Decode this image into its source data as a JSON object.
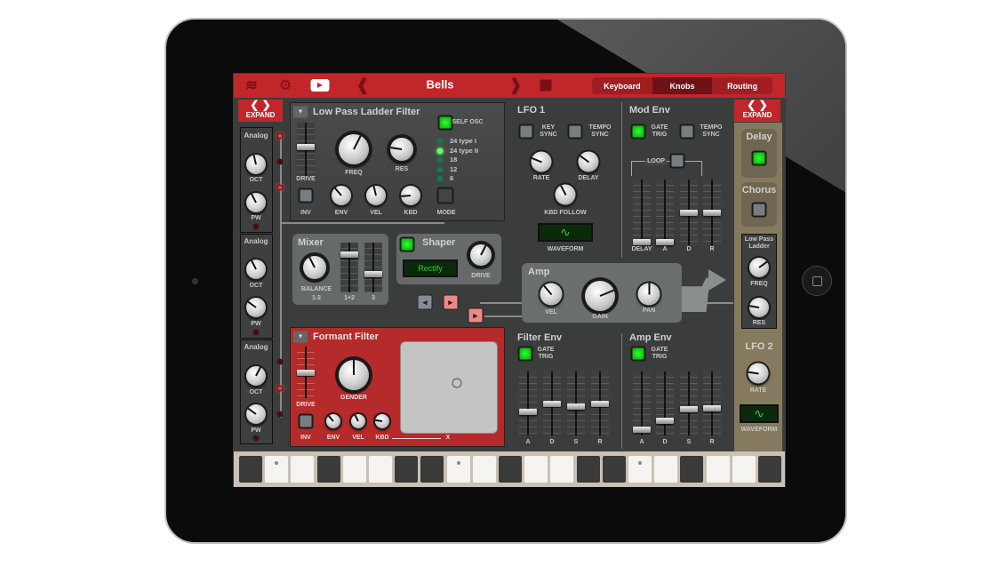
{
  "topbar": {
    "preset_name": "Bells",
    "tabs": [
      {
        "label": "Keyboard",
        "active": false
      },
      {
        "label": "Knobs",
        "active": true
      },
      {
        "label": "Routing",
        "active": false
      }
    ],
    "icons": [
      "logo-icon",
      "gear-icon",
      "video-play-icon",
      "chevron-left-icon",
      "chevron-right-icon",
      "save-icon"
    ]
  },
  "colors": {
    "accent_red": "#c1262b",
    "panel_bg": "#3e4040",
    "led_green": "#33ff33",
    "formant_red": "#b52a2a",
    "side_tan": "#8a7d62"
  },
  "left": {
    "expand": "EXPAND",
    "oscillators": [
      {
        "type": "Analog",
        "oct_label": "OCT",
        "pw_label": "PW",
        "oct": 0.45,
        "pw": 0.4
      },
      {
        "type": "Analog",
        "oct_label": "OCT",
        "pw_label": "PW",
        "oct": 0.4,
        "pw": 0.3
      },
      {
        "type": "Analog",
        "oct_label": "OCT",
        "pw_label": "PW",
        "oct": 0.6,
        "pw": 0.3
      }
    ]
  },
  "lpf": {
    "title": "Low Pass Ladder Filter",
    "self_osc": "SELF OSC",
    "self_osc_on": true,
    "drive_label": "DRIVE",
    "drive": 0.55,
    "freq_label": "FREQ",
    "freq": 0.6,
    "res_label": "RES",
    "res": 0.2,
    "inv_label": "INV",
    "env_label": "ENV",
    "env": 0.35,
    "vel_label": "VEL",
    "vel": 0.45,
    "kbd_label": "KBD",
    "kbd": 0.15,
    "mode_label": "MODE",
    "slopes": [
      {
        "label": "24 type I",
        "on": false
      },
      {
        "label": "24 type II",
        "on": true
      },
      {
        "label": "18",
        "on": false
      },
      {
        "label": "12",
        "on": false
      },
      {
        "label": "6",
        "on": false
      }
    ]
  },
  "mixer": {
    "title": "Mixer",
    "balance_label": "BALANCE",
    "balance_sub": "1-2",
    "balance": 0.4,
    "s12_label": "1+2",
    "s12": 0.8,
    "s3_label": "3",
    "s3": 0.35
  },
  "shaper": {
    "title": "Shaper",
    "on": true,
    "mode": "Rectify",
    "drive_label": "DRIVE",
    "drive": 0.6
  },
  "formant": {
    "title": "Formant Filter",
    "drive_label": "DRIVE",
    "drive": 0.5,
    "gender_label": "GENDER",
    "gender": 0.5,
    "env": 0.35,
    "vel": 0.4,
    "kbd": 0.2,
    "chain": [
      "INV",
      "ENV",
      "VEL",
      "KBD",
      "X"
    ]
  },
  "lfo1": {
    "title": "LFO 1",
    "key_sync": "KEY SYNC",
    "tempo_sync": "TEMPO SYNC",
    "rate_label": "RATE",
    "rate": 0.25,
    "delay_label": "DELAY",
    "delay": 0.3,
    "kbd_follow_label": "KBD FOLLOW",
    "kbd_follow": 0.4,
    "waveform_label": "WAVEFORM",
    "waveform": "sine"
  },
  "mod_env": {
    "title": "Mod Env",
    "gate_trig": "GATE TRIG",
    "gate_on": true,
    "tempo_sync": "TEMPO SYNC",
    "loop": "LOOP",
    "sliders": [
      {
        "label": "DELAY",
        "value": 0
      },
      {
        "label": "A",
        "value": 0
      },
      {
        "label": "D",
        "value": 0.5
      },
      {
        "label": "R",
        "value": 0.5
      }
    ]
  },
  "amp": {
    "title": "Amp",
    "vel_label": "VEL",
    "vel": 0.35,
    "gain_label": "GAIN",
    "gain": 0.75,
    "pan_label": "PAN",
    "pan": 0.5
  },
  "filter_env": {
    "title": "Filter Env",
    "gate_trig": "GATE TRIG",
    "gate_on": true,
    "sliders": [
      {
        "label": "A",
        "value": 0.35
      },
      {
        "label": "D",
        "value": 0.5
      },
      {
        "label": "S",
        "value": 0.45
      },
      {
        "label": "R",
        "value": 0.5
      }
    ]
  },
  "amp_env": {
    "title": "Amp Env",
    "gate_trig": "GATE TRIG",
    "gate_on": true,
    "sliders": [
      {
        "label": "A",
        "value": 0.05
      },
      {
        "label": "D",
        "value": 0.2
      },
      {
        "label": "S",
        "value": 0.4
      },
      {
        "label": "R",
        "value": 0.42
      }
    ]
  },
  "right": {
    "expand": "EXPAND",
    "delay": "Delay",
    "delay_on": true,
    "chorus": "Chorus",
    "chorus_on": false,
    "lpl": "Low Pass Ladder",
    "lpl_freq_label": "FREQ",
    "lpl_freq": 0.7,
    "lpl_res_label": "RES",
    "lpl_res": 0.2,
    "lfo2": "LFO 2",
    "lfo2_rate_label": "RATE",
    "lfo2_rate": 0.2,
    "waveform_label": "WAVEFORM"
  },
  "keyboard": {
    "keys": [
      "d",
      "w",
      "w",
      "d",
      "w",
      "w",
      "d",
      "d",
      "w",
      "w",
      "d",
      "w",
      "w",
      "d",
      "d",
      "w",
      "w",
      "d",
      "w",
      "w",
      "d"
    ],
    "dots": [
      1,
      8,
      15
    ]
  }
}
